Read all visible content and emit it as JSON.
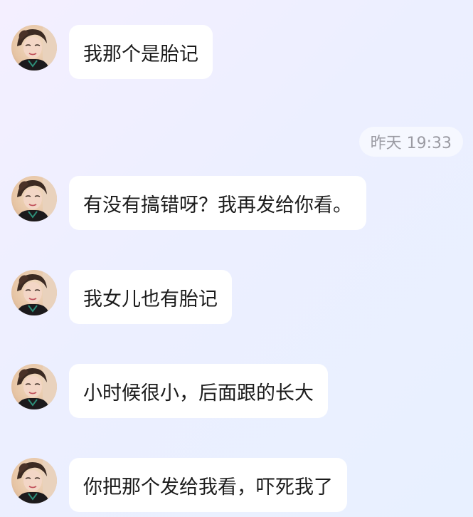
{
  "timestamp": "昨天 19:33",
  "messages": [
    {
      "text": "我那个是胎记"
    },
    {
      "text": "有没有搞错呀？我再发给你看。"
    },
    {
      "text": "我女儿也有胎记"
    },
    {
      "text": "小时候很小，后面跟的长大"
    },
    {
      "text": "你把那个发给我看，吓死我了"
    }
  ],
  "colors": {
    "bubble": "#ffffff",
    "text": "#1b1b1b",
    "timestamp": "#9b9ba3",
    "background_start": "#f4efff",
    "background_end": "#e8f0ff"
  },
  "icons": {
    "avatar": "user-avatar-photo"
  }
}
